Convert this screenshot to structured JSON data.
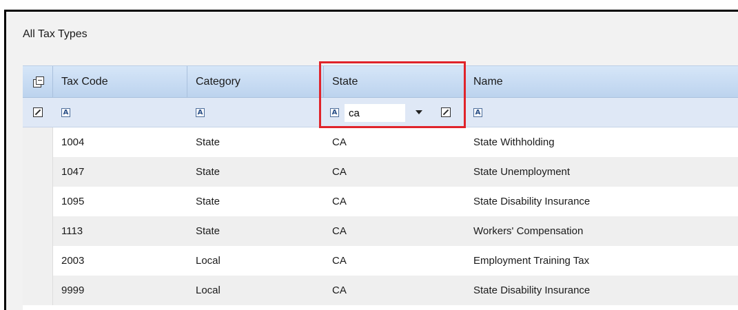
{
  "panel": {
    "title": "All Tax Types"
  },
  "columns": [
    {
      "label": "Tax Code"
    },
    {
      "label": "Category"
    },
    {
      "label": "State"
    },
    {
      "label": "Name"
    }
  ],
  "filter": {
    "state_value": "ca"
  },
  "rows": [
    {
      "code": "1004",
      "category": "State",
      "state": "CA",
      "name": "State Withholding"
    },
    {
      "code": "1047",
      "category": "State",
      "state": "CA",
      "name": "State Unemployment"
    },
    {
      "code": "1095",
      "category": "State",
      "state": "CA",
      "name": "State Disability Insurance"
    },
    {
      "code": "1113",
      "category": "State",
      "state": "CA",
      "name": "Workers' Compensation"
    },
    {
      "code": "2003",
      "category": "Local",
      "state": "CA",
      "name": "Employment Training Tax"
    },
    {
      "code": "9999",
      "category": "Local",
      "state": "CA",
      "name": "State Disability Insurance"
    }
  ],
  "icons": {
    "column_chooser": "column-chooser-icon",
    "filter_operator": "text-filter-operator-icon",
    "clear_filter": "clear-filter-icon",
    "dropdown": "chevron-down-icon"
  },
  "colors": {
    "header_bg": "#c8dcf4",
    "filter_row_bg": "#dfe8f6",
    "highlight": "#e0232a"
  }
}
